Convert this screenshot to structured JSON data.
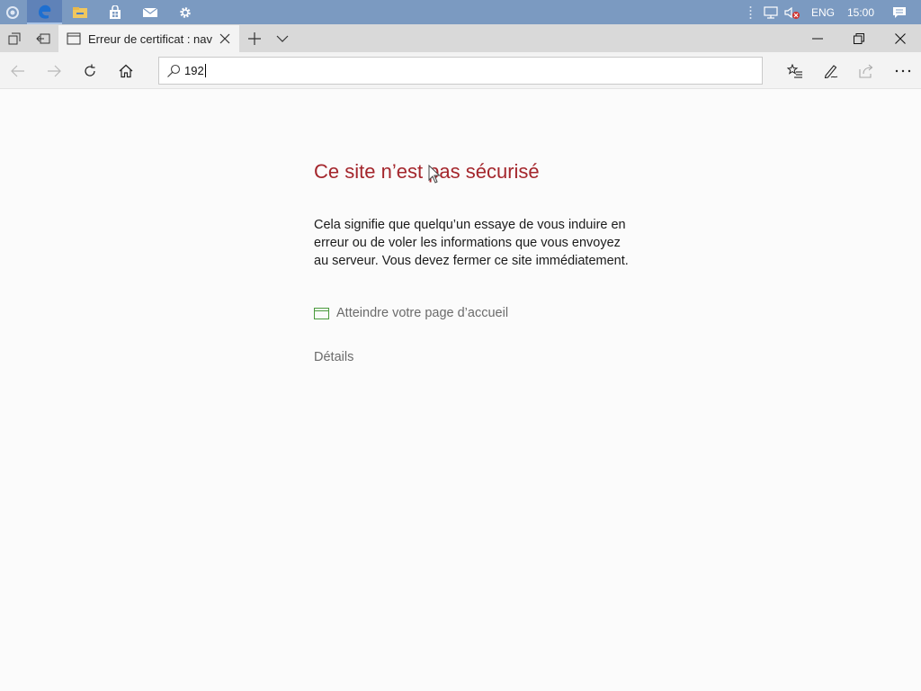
{
  "taskbar": {
    "tray": {
      "language": "ENG",
      "clock": "15:00"
    }
  },
  "tab": {
    "title": "Erreur de certificat : nav"
  },
  "address_bar": {
    "value": "192"
  },
  "page": {
    "title": "Ce site n’est pas sécurisé",
    "description": "Cela signifie que quelqu’un essaye de vous induire en erreur ou de voler les informations que vous envoyez au serveur. Vous devez fermer ce site immédiatement.",
    "home_link": "Atteindre votre page d’accueil",
    "details_link": "Détails"
  },
  "colors": {
    "taskbar": "#7b9ac1",
    "error_title": "#a4262c",
    "link_gray": "#6b6b6b",
    "home_icon_green": "#4a9a3c"
  }
}
